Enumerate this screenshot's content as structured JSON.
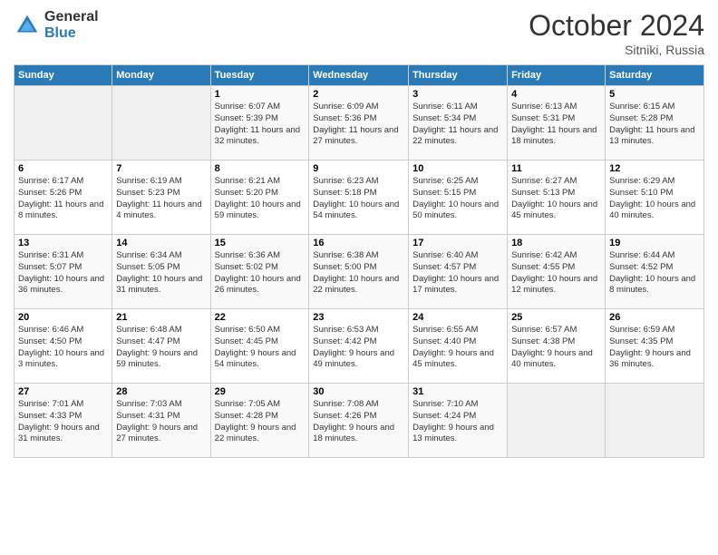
{
  "logo": {
    "general": "General",
    "blue": "Blue"
  },
  "header": {
    "month": "October 2024",
    "location": "Sitniki, Russia"
  },
  "weekdays": [
    "Sunday",
    "Monday",
    "Tuesday",
    "Wednesday",
    "Thursday",
    "Friday",
    "Saturday"
  ],
  "weeks": [
    [
      {
        "day": "",
        "sunrise": "",
        "sunset": "",
        "daylight": ""
      },
      {
        "day": "",
        "sunrise": "",
        "sunset": "",
        "daylight": ""
      },
      {
        "day": "1",
        "sunrise": "Sunrise: 6:07 AM",
        "sunset": "Sunset: 5:39 PM",
        "daylight": "Daylight: 11 hours and 32 minutes."
      },
      {
        "day": "2",
        "sunrise": "Sunrise: 6:09 AM",
        "sunset": "Sunset: 5:36 PM",
        "daylight": "Daylight: 11 hours and 27 minutes."
      },
      {
        "day": "3",
        "sunrise": "Sunrise: 6:11 AM",
        "sunset": "Sunset: 5:34 PM",
        "daylight": "Daylight: 11 hours and 22 minutes."
      },
      {
        "day": "4",
        "sunrise": "Sunrise: 6:13 AM",
        "sunset": "Sunset: 5:31 PM",
        "daylight": "Daylight: 11 hours and 18 minutes."
      },
      {
        "day": "5",
        "sunrise": "Sunrise: 6:15 AM",
        "sunset": "Sunset: 5:28 PM",
        "daylight": "Daylight: 11 hours and 13 minutes."
      }
    ],
    [
      {
        "day": "6",
        "sunrise": "Sunrise: 6:17 AM",
        "sunset": "Sunset: 5:26 PM",
        "daylight": "Daylight: 11 hours and 8 minutes."
      },
      {
        "day": "7",
        "sunrise": "Sunrise: 6:19 AM",
        "sunset": "Sunset: 5:23 PM",
        "daylight": "Daylight: 11 hours and 4 minutes."
      },
      {
        "day": "8",
        "sunrise": "Sunrise: 6:21 AM",
        "sunset": "Sunset: 5:20 PM",
        "daylight": "Daylight: 10 hours and 59 minutes."
      },
      {
        "day": "9",
        "sunrise": "Sunrise: 6:23 AM",
        "sunset": "Sunset: 5:18 PM",
        "daylight": "Daylight: 10 hours and 54 minutes."
      },
      {
        "day": "10",
        "sunrise": "Sunrise: 6:25 AM",
        "sunset": "Sunset: 5:15 PM",
        "daylight": "Daylight: 10 hours and 50 minutes."
      },
      {
        "day": "11",
        "sunrise": "Sunrise: 6:27 AM",
        "sunset": "Sunset: 5:13 PM",
        "daylight": "Daylight: 10 hours and 45 minutes."
      },
      {
        "day": "12",
        "sunrise": "Sunrise: 6:29 AM",
        "sunset": "Sunset: 5:10 PM",
        "daylight": "Daylight: 10 hours and 40 minutes."
      }
    ],
    [
      {
        "day": "13",
        "sunrise": "Sunrise: 6:31 AM",
        "sunset": "Sunset: 5:07 PM",
        "daylight": "Daylight: 10 hours and 36 minutes."
      },
      {
        "day": "14",
        "sunrise": "Sunrise: 6:34 AM",
        "sunset": "Sunset: 5:05 PM",
        "daylight": "Daylight: 10 hours and 31 minutes."
      },
      {
        "day": "15",
        "sunrise": "Sunrise: 6:36 AM",
        "sunset": "Sunset: 5:02 PM",
        "daylight": "Daylight: 10 hours and 26 minutes."
      },
      {
        "day": "16",
        "sunrise": "Sunrise: 6:38 AM",
        "sunset": "Sunset: 5:00 PM",
        "daylight": "Daylight: 10 hours and 22 minutes."
      },
      {
        "day": "17",
        "sunrise": "Sunrise: 6:40 AM",
        "sunset": "Sunset: 4:57 PM",
        "daylight": "Daylight: 10 hours and 17 minutes."
      },
      {
        "day": "18",
        "sunrise": "Sunrise: 6:42 AM",
        "sunset": "Sunset: 4:55 PM",
        "daylight": "Daylight: 10 hours and 12 minutes."
      },
      {
        "day": "19",
        "sunrise": "Sunrise: 6:44 AM",
        "sunset": "Sunset: 4:52 PM",
        "daylight": "Daylight: 10 hours and 8 minutes."
      }
    ],
    [
      {
        "day": "20",
        "sunrise": "Sunrise: 6:46 AM",
        "sunset": "Sunset: 4:50 PM",
        "daylight": "Daylight: 10 hours and 3 minutes."
      },
      {
        "day": "21",
        "sunrise": "Sunrise: 6:48 AM",
        "sunset": "Sunset: 4:47 PM",
        "daylight": "Daylight: 9 hours and 59 minutes."
      },
      {
        "day": "22",
        "sunrise": "Sunrise: 6:50 AM",
        "sunset": "Sunset: 4:45 PM",
        "daylight": "Daylight: 9 hours and 54 minutes."
      },
      {
        "day": "23",
        "sunrise": "Sunrise: 6:53 AM",
        "sunset": "Sunset: 4:42 PM",
        "daylight": "Daylight: 9 hours and 49 minutes."
      },
      {
        "day": "24",
        "sunrise": "Sunrise: 6:55 AM",
        "sunset": "Sunset: 4:40 PM",
        "daylight": "Daylight: 9 hours and 45 minutes."
      },
      {
        "day": "25",
        "sunrise": "Sunrise: 6:57 AM",
        "sunset": "Sunset: 4:38 PM",
        "daylight": "Daylight: 9 hours and 40 minutes."
      },
      {
        "day": "26",
        "sunrise": "Sunrise: 6:59 AM",
        "sunset": "Sunset: 4:35 PM",
        "daylight": "Daylight: 9 hours and 36 minutes."
      }
    ],
    [
      {
        "day": "27",
        "sunrise": "Sunrise: 7:01 AM",
        "sunset": "Sunset: 4:33 PM",
        "daylight": "Daylight: 9 hours and 31 minutes."
      },
      {
        "day": "28",
        "sunrise": "Sunrise: 7:03 AM",
        "sunset": "Sunset: 4:31 PM",
        "daylight": "Daylight: 9 hours and 27 minutes."
      },
      {
        "day": "29",
        "sunrise": "Sunrise: 7:05 AM",
        "sunset": "Sunset: 4:28 PM",
        "daylight": "Daylight: 9 hours and 22 minutes."
      },
      {
        "day": "30",
        "sunrise": "Sunrise: 7:08 AM",
        "sunset": "Sunset: 4:26 PM",
        "daylight": "Daylight: 9 hours and 18 minutes."
      },
      {
        "day": "31",
        "sunrise": "Sunrise: 7:10 AM",
        "sunset": "Sunset: 4:24 PM",
        "daylight": "Daylight: 9 hours and 13 minutes."
      },
      {
        "day": "",
        "sunrise": "",
        "sunset": "",
        "daylight": ""
      },
      {
        "day": "",
        "sunrise": "",
        "sunset": "",
        "daylight": ""
      }
    ]
  ]
}
